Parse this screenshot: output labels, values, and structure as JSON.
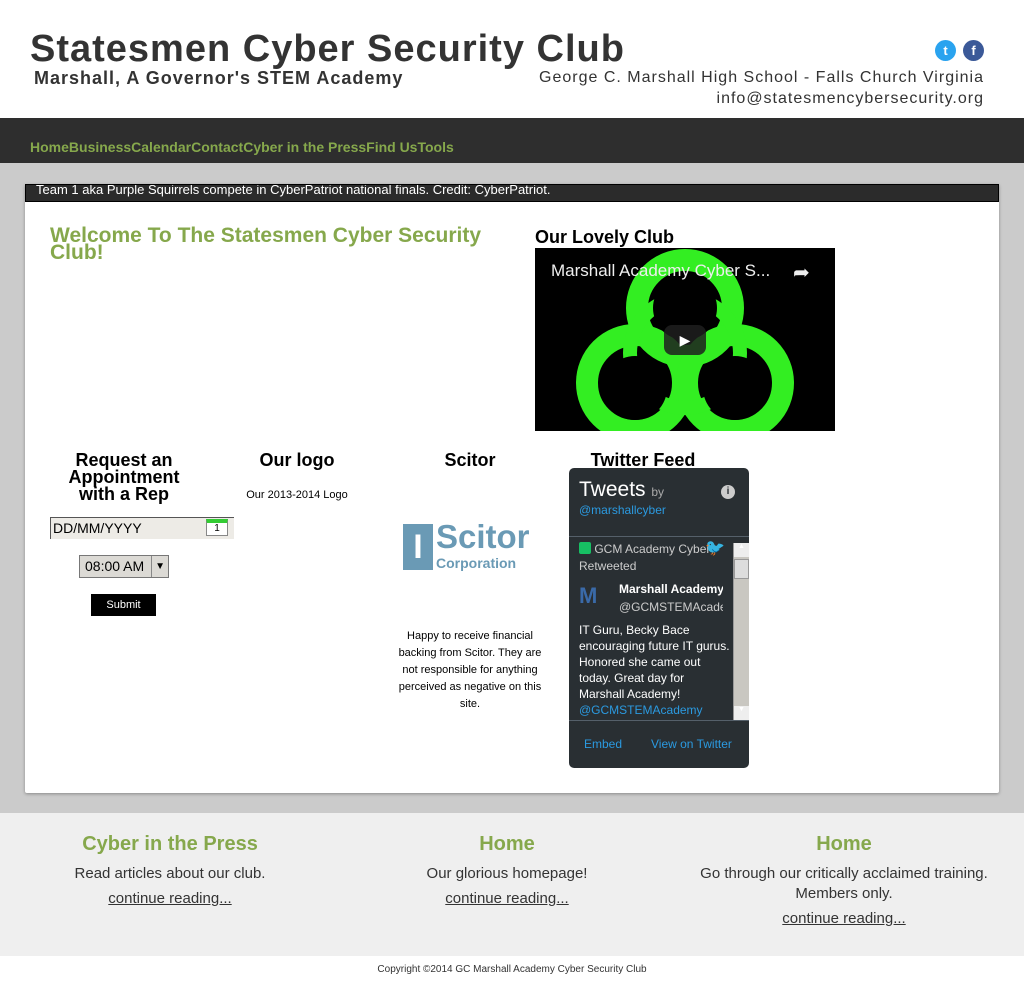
{
  "header": {
    "title": "Statesmen Cyber Security Club",
    "subtitle": "Marshall, A Governor's STEM Academy",
    "school": "George C. Marshall High School - Falls Church Virginia",
    "email": "info@statesmencybersecurity.org",
    "twitter_color": "#2aa3ef",
    "facebook_color": "#3b5998"
  },
  "nav": {
    "items": [
      "Home",
      "Business",
      "Calendar",
      "Contact",
      "Cyber in the Press",
      "Find Us",
      "Tools"
    ],
    "color": "#86a84c"
  },
  "slideshow": {
    "caption": "Team 1 aka Purple Squirrels compete in CyberPatriot national finals. Credit: CyberPatriot."
  },
  "main": {
    "welcome": "Welcome To The Statesmen Cyber Security Club!",
    "club_heading": "Our Lovely Club",
    "video_title": "Marshall Academy Cyber S..."
  },
  "appointment": {
    "heading": "Request an Appointment with a Rep",
    "date_placeholder": "DD/MM/YYYY",
    "time_value": "08:00 AM",
    "submit": "Submit"
  },
  "logo": {
    "heading": "Our logo",
    "caption": "Our 2013-2014 Logo"
  },
  "scitor": {
    "heading": "Scitor",
    "logo_text": "Scitor",
    "logo_sub": "Corporation",
    "text": "Happy to receive financial backing from Scitor. They are not responsible for anything perceived as negative on this site."
  },
  "twitter": {
    "heading": "Twitter Feed",
    "tweets": "Tweets",
    "by": "by",
    "handle": "@marshallcyber",
    "retweeted": "GCM Academy Cyber Retweeted",
    "author": "Marshall Academy",
    "author_handle": "@GCMSTEMAcademy",
    "text": "IT Guru, Becky Bace encouraging future IT gurus. Honored she came out today. Great day for Marshall Academy!",
    "mention": "@GCMSTEMAcademy",
    "embed": "Embed",
    "view": "View on Twitter"
  },
  "footer": {
    "cols": [
      {
        "title": "Cyber in the Press",
        "desc": "Read articles about our club.",
        "link": "continue reading..."
      },
      {
        "title": "Home",
        "desc": "Our glorious homepage!",
        "link": "continue reading..."
      },
      {
        "title": "Home",
        "desc": "Go through our critically acclaimed training. Members only.",
        "link": "continue reading..."
      }
    ],
    "copyright": "Copyright ©2014 GC Marshall Academy Cyber Security Club"
  }
}
